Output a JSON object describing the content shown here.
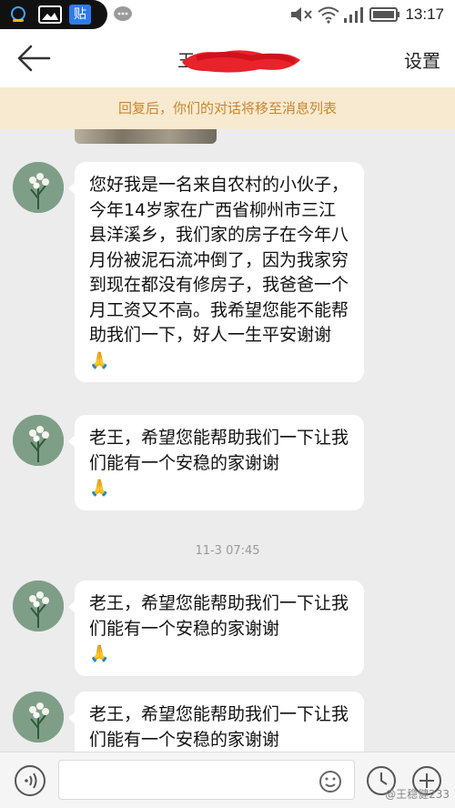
{
  "status_bar": {
    "time": "13:17",
    "app_badge": "贴"
  },
  "nav": {
    "title": "王",
    "settings_label": "设置"
  },
  "banner": {
    "text": "回复后，你们的对话将移至消息列表"
  },
  "messages": [
    {
      "text": "您好我是一名来自农村的小伙子，今年14岁家在广西省柳州市三江县洋溪乡，我们家的房子在今年八月份被泥石流冲倒了，因为我家穷到现在都没有修房子，我爸爸一个月工资又不高。我希望您能不能帮助我们一下，好人一生平安谢谢",
      "emoji": "🙏"
    },
    {
      "text": "老王，希望您能帮助我们一下让我们能有一个安稳的家谢谢",
      "emoji": "🙏"
    },
    {
      "text": "老王，希望您能帮助我们一下让我们能有一个安稳的家谢谢",
      "emoji": "🙏"
    },
    {
      "text": "老王，希望您能帮助我们一下让我们能有一个安稳的家谢谢"
    }
  ],
  "timestamp": "11-3 07:45",
  "input": {
    "placeholder": "",
    "value": ""
  },
  "watermark": "@王稳健233",
  "colors": {
    "banner_bg": "#f8ead0",
    "banner_text": "#c9852f",
    "chat_bg": "#ececec",
    "redaction": "#e8232a"
  }
}
